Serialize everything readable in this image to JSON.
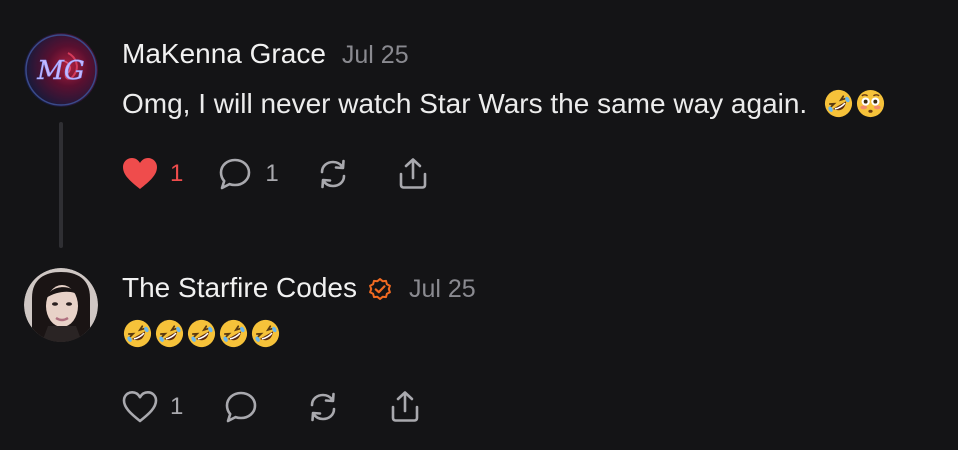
{
  "comments": [
    {
      "author": "MaKenna Grace",
      "date": "Jul 25",
      "text": "Omg, I will never watch Star Wars the same way again.",
      "emojis": [
        "rolling-on-floor-laughing",
        "flushed-face"
      ],
      "avatar_initials": "MG",
      "liked": true,
      "like_count": "1",
      "reply_count": "1",
      "verified": false
    },
    {
      "author": "The Starfire Codes",
      "date": "Jul 25",
      "text": "",
      "emojis": [
        "rolling-on-floor-laughing",
        "rolling-on-floor-laughing",
        "rolling-on-floor-laughing",
        "rolling-on-floor-laughing",
        "rolling-on-floor-laughing"
      ],
      "liked": false,
      "like_count": "1",
      "reply_count": "",
      "verified": true
    }
  ],
  "colors": {
    "background": "#141416",
    "liked": "#ef4c4c",
    "verified": "#f26a21",
    "muted": "#8a8a90"
  },
  "icons": {
    "like": "heart-icon",
    "reply": "speech-bubble-icon",
    "restack": "restack-icon",
    "share": "share-icon"
  }
}
